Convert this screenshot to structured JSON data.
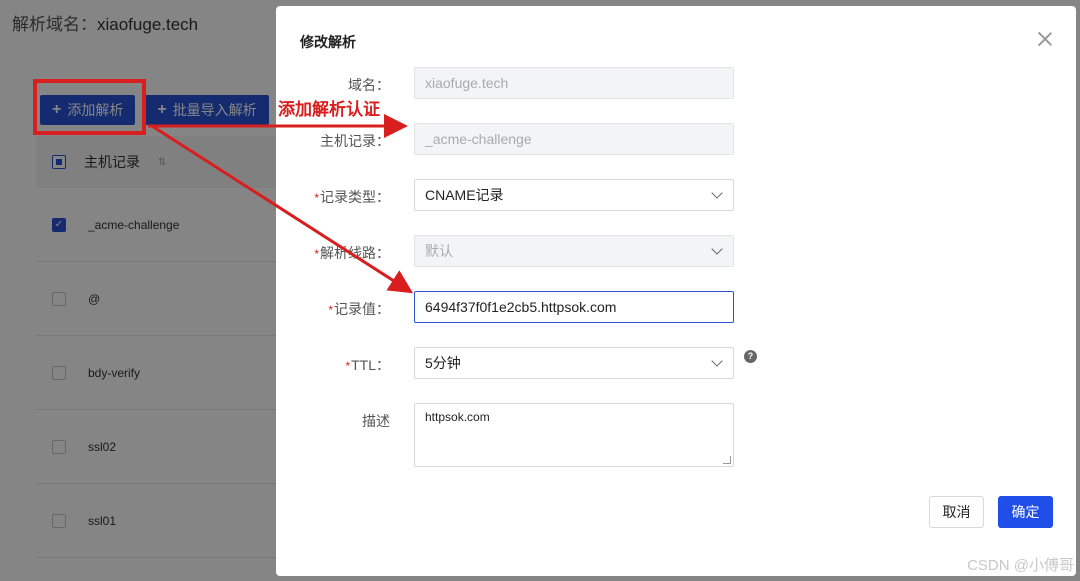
{
  "background": {
    "title_label": "解析域名：",
    "title_value": "xiaofuge.tech",
    "toolbar": {
      "add_label": "添加解析",
      "import_label": "批量导入解析"
    },
    "table": {
      "header_label": "主机记录",
      "rows": [
        "_acme-challenge",
        "@",
        "bdy-verify",
        "ssl02",
        "ssl01"
      ]
    }
  },
  "dialog": {
    "title": "修改解析",
    "fields": {
      "domain": {
        "label": "域名：",
        "value": "xiaofuge.tech"
      },
      "host": {
        "label": "主机记录：",
        "value": "_acme-challenge"
      },
      "type": {
        "label": "记录类型：",
        "value": "CNAME记录"
      },
      "line": {
        "label": "解析线路：",
        "value": "默认"
      },
      "value": {
        "label": "记录值：",
        "value": "6494f37f0f1e2cb5.httpsok.com"
      },
      "ttl": {
        "label": "TTL：",
        "value": "5分钟"
      },
      "desc": {
        "label": "描述",
        "value": "httpsok.com"
      }
    },
    "buttons": {
      "cancel": "取消",
      "ok": "确定"
    }
  },
  "annotation": {
    "text": "添加解析认证",
    "color": "#d81e1e"
  },
  "watermark": "CSDN @小傅哥"
}
